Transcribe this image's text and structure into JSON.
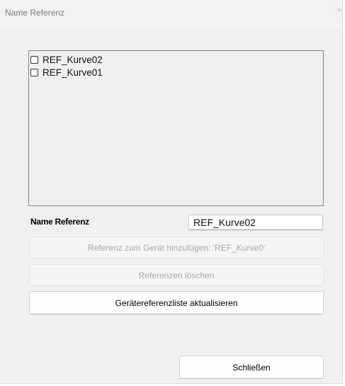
{
  "window": {
    "title": "Name Referenz",
    "close_glyph": "×"
  },
  "list": {
    "items": [
      {
        "label": "REF_Kurve02",
        "checked": false
      },
      {
        "label": "REF_Kurve01",
        "checked": false
      }
    ]
  },
  "form": {
    "name_label": "Name Referenz",
    "name_value": "REF_Kurve02"
  },
  "buttons": {
    "add_label": "Referenz zum Gerät hinzufügen: 'REF_Kurve0'",
    "delete_label": "Referenzen löschen",
    "refresh_label": "Gerätereferenzliste aktualisieren",
    "close_label": "Schließen"
  }
}
